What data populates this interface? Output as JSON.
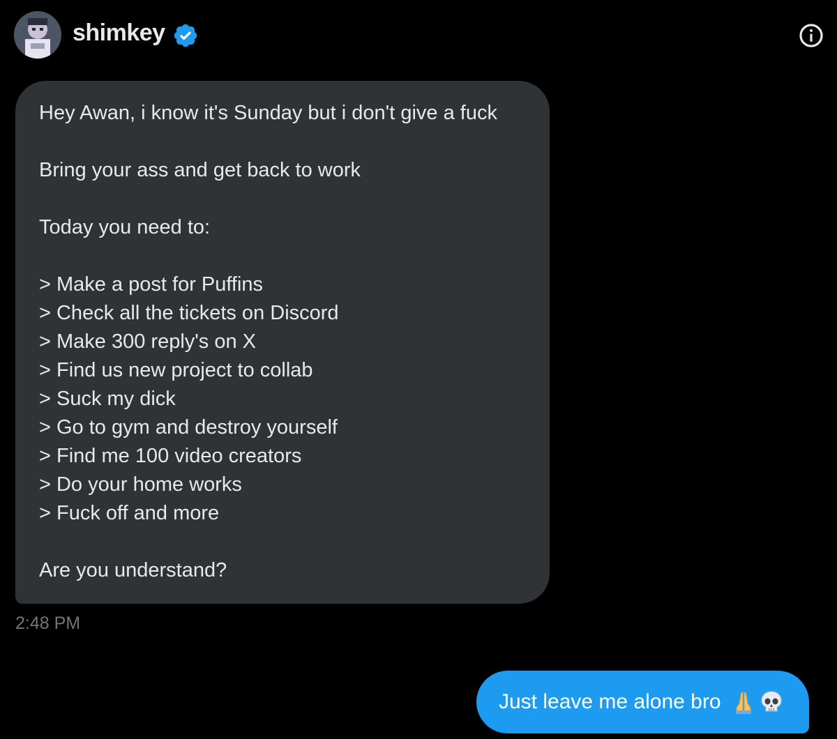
{
  "conversation": {
    "contact_name": "shimkey",
    "verified_icon": "verified-badge-icon",
    "info_icon": "info-icon",
    "avatar_icon": "avatar-image"
  },
  "incoming_message": {
    "lines": [
      "Hey Awan, i know it's Sunday but i don't give a fuck",
      "",
      "Bring your ass and get back to work",
      "",
      "Today you need to:",
      "",
      "> Make a post for Puffins",
      "> Check all the tickets on Discord",
      "> Make 300 reply's on X",
      "> Find us new project to collab",
      "> Suck my dick",
      "> Go to gym and destroy yourself",
      "> Find me 100 video creators",
      "> Do your home works",
      "> Fuck off and more",
      "",
      "Are you understand?"
    ],
    "timestamp": "2:48 PM"
  },
  "outgoing_message": {
    "text": "Just leave me alone bro",
    "emojis": [
      "folded-hands-icon",
      "skull-icon"
    ]
  },
  "colors": {
    "background": "#000000",
    "incoming_bubble": "#2f3336",
    "outgoing_bubble": "#1d9bf0",
    "primary_text": "#e7e9ea",
    "secondary_text": "#71767b",
    "verified_blue": "#1d9bf0"
  }
}
